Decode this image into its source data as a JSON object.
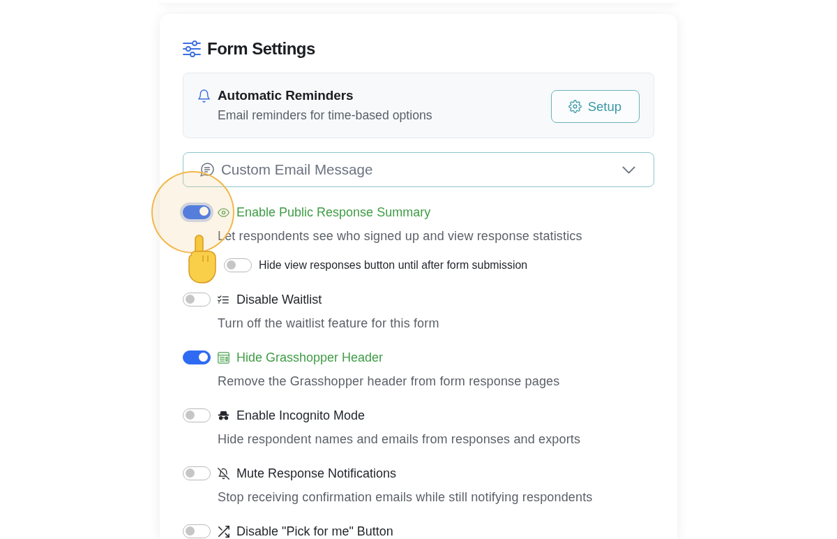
{
  "header": {
    "title": "Form Settings"
  },
  "reminders": {
    "title": "Automatic Reminders",
    "description": "Email reminders for time-based options",
    "button": "Setup"
  },
  "email_message": {
    "label": "Custom Email Message",
    "expanded": false
  },
  "settings": [
    {
      "label": "Enable Public Response Summary",
      "on": true,
      "highlighted": true,
      "description": "Let respondents see who signed up and view response statistics",
      "suboptions": [
        {
          "label": "Hide view responses button until after form submission",
          "on": false
        }
      ]
    },
    {
      "label": "Disable Waitlist",
      "on": false,
      "highlighted": false,
      "description": "Turn off the waitlist feature for this form"
    },
    {
      "label": "Hide Grasshopper Header",
      "on": true,
      "highlighted": false,
      "description": "Remove the Grasshopper header from form response pages"
    },
    {
      "label": "Enable Incognito Mode",
      "on": false,
      "highlighted": false,
      "description": "Hide respondent names and emails from responses and exports"
    },
    {
      "label": "Mute Response Notifications",
      "on": false,
      "highlighted": false,
      "description": "Stop receiving confirmation emails while still notifying respondents"
    },
    {
      "label": "Disable \"Pick for me\" Button",
      "on": false,
      "highlighted": false
    }
  ]
}
